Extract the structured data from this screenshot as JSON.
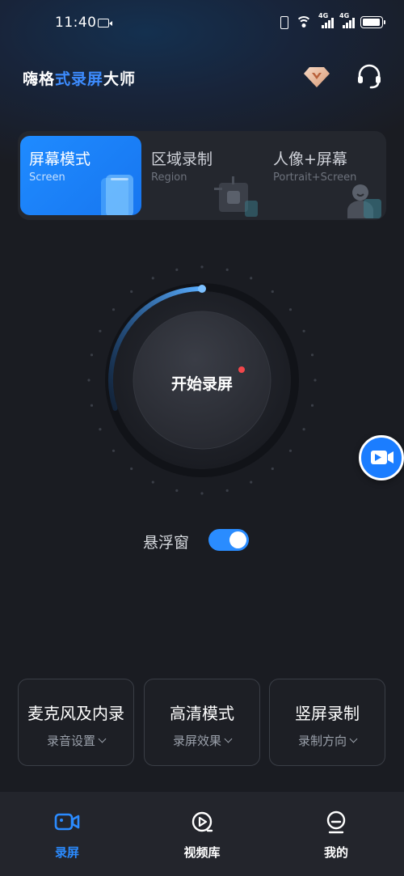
{
  "status_bar": {
    "time": "11:40",
    "network_label_1": "4G",
    "network_label_2": "4G",
    "battery_level": 0.95
  },
  "header": {
    "title_parts": [
      "嗨格",
      "式录屏",
      "大师"
    ],
    "vip_icon": "diamond-icon",
    "support_icon": "headset-icon"
  },
  "modes": [
    {
      "title": "屏幕模式",
      "subtitle": "Screen",
      "active": true
    },
    {
      "title": "区域录制",
      "subtitle": "Region",
      "active": false
    },
    {
      "title": "人像+屏幕",
      "subtitle": "Portrait+Screen",
      "active": false
    }
  ],
  "record": {
    "label": "开始录屏",
    "progress": 0.3
  },
  "floating_window": {
    "label": "悬浮窗",
    "enabled": true
  },
  "settings": [
    {
      "title": "麦克风及内录",
      "subtitle": "录音设置"
    },
    {
      "title": "高清模式",
      "subtitle": "录屏效果"
    },
    {
      "title": "竖屏录制",
      "subtitle": "录制方向"
    }
  ],
  "bottom_nav": [
    {
      "label": "录屏",
      "icon": "video-camera-icon",
      "active": true
    },
    {
      "label": "视频库",
      "icon": "play-circle-icon",
      "active": false
    },
    {
      "label": "我的",
      "icon": "profile-icon",
      "active": false
    }
  ],
  "colors": {
    "accent": "#2b8bff",
    "background": "#1a1c22",
    "record_dot": "#f2474b"
  }
}
